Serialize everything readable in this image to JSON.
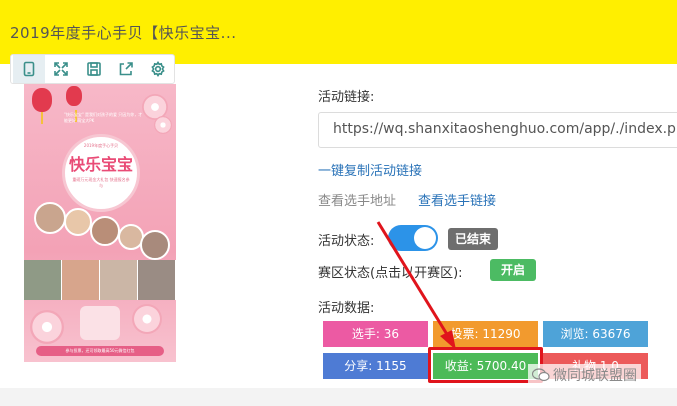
{
  "header": {
    "title": "2019年度手心手贝【快乐宝宝..."
  },
  "toolbar": {
    "items": [
      {
        "icon": "mobile-icon",
        "active": true
      },
      {
        "icon": "expand-icon"
      },
      {
        "icon": "save-icon"
      },
      {
        "icon": "share-icon"
      },
      {
        "icon": "gear-icon"
      }
    ]
  },
  "poster": {
    "tagline": "\"快乐宝宝\" 是我们对孩子的爱 只因为你，才能更好 萌宝大PK",
    "badge_small": "2019年度手心手贝",
    "badge_title": "快乐宝宝",
    "badge_sub": "重磅万元现金大礼包 快速报名参与",
    "footer": "参与投票，还可领取最高50元微信红包"
  },
  "activity": {
    "link_label": "活动链接:",
    "link_url": "https://wq.shanxitaoshenghuo.com/app/./index.php",
    "copy_link": "一键复制活动链接",
    "view_player_address": "查看选手地址",
    "view_player_link": "查看选手链接",
    "status_label": "活动状态:",
    "status_badge": "已结束",
    "zone_label": "赛区状态(点击以开赛区):",
    "zone_badge": "开启",
    "data_label": "活动数据:"
  },
  "stats": {
    "players": "选手: 36",
    "votes": "投票: 11290",
    "views": "浏览: 63676",
    "shares": "分享: 1155",
    "income": "收益: 5700.40",
    "gifts": "礼物 1 0"
  },
  "watermark": {
    "text": "微同城联盟圈"
  },
  "colors": {
    "title_bar": "#ffef00",
    "link": "#2a73b8",
    "toggle": "#2c93e8",
    "highlight": "#e0141c"
  }
}
